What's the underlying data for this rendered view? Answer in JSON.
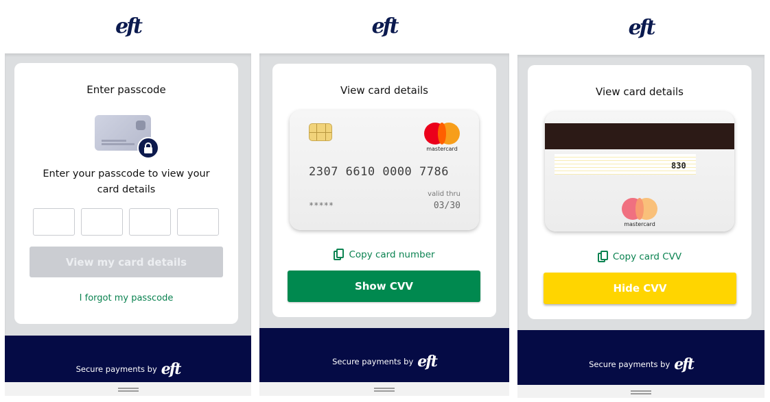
{
  "brand": {
    "logo_text": "eft"
  },
  "footer": {
    "secure_text": "Secure payments by",
    "logo_text": "eft"
  },
  "panel1": {
    "title": "Enter passcode",
    "prompt_line1": "Enter your passcode to view your",
    "prompt_line2": "card details",
    "pin_count": 4,
    "button_label": "View my card details",
    "forgot_link": "I forgot my passcode"
  },
  "panel2": {
    "title": "View card details",
    "card_number": "2307 6610 0000 7786",
    "masked_cvv": "*****",
    "valid_thru_label": "valid thru",
    "expiry": "03/30",
    "card_brand": "mastercard",
    "copy_label": "Copy card number",
    "button_label": "Show CVV"
  },
  "panel3": {
    "title": "View card details",
    "cvv": "830",
    "card_brand": "mastercard",
    "copy_label": "Copy card CVV",
    "button_label": "Hide CVV"
  },
  "colors": {
    "brand_navy": "#050b45",
    "success_green": "#00894f",
    "warning_yellow": "#ffd500",
    "disabled_gray": "#cbcdd2"
  }
}
